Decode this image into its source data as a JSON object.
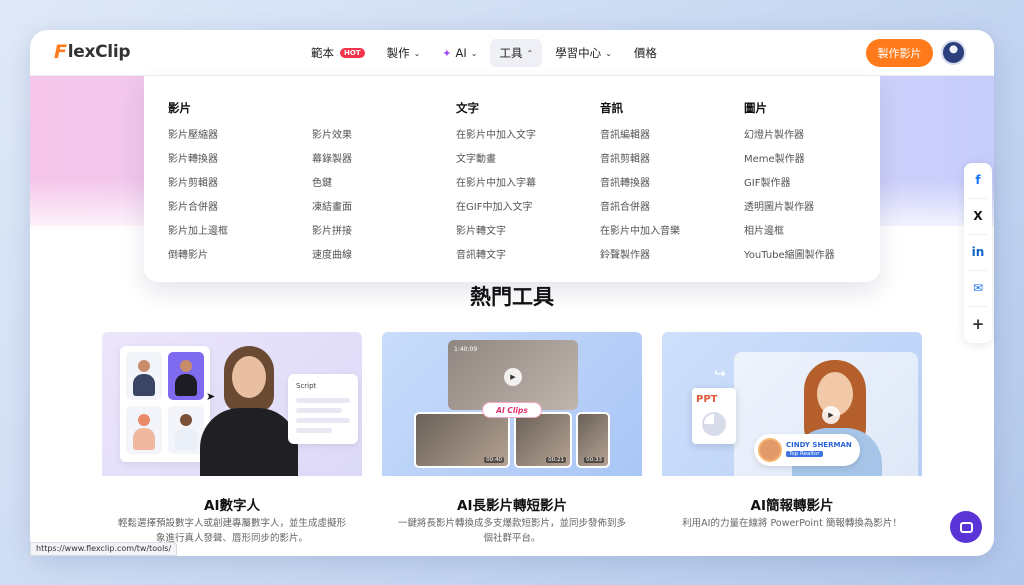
{
  "header": {
    "logo": "FlexClip",
    "nav": [
      {
        "label": "範本",
        "badge": "HOT"
      },
      {
        "label": "製作"
      },
      {
        "label": "AI"
      },
      {
        "label": "工具"
      },
      {
        "label": "學習中心"
      },
      {
        "label": "價格"
      }
    ],
    "cta": "製作影片"
  },
  "dropdown": {
    "columns": [
      {
        "title": "影片",
        "items": [
          "影片壓縮器",
          "影片轉換器",
          "影片剪輯器",
          "影片合併器",
          "影片加上邊框",
          "倒轉影片"
        ]
      },
      {
        "title": "",
        "items": [
          "影片效果",
          "幕錄製器",
          "色鍵",
          "凍結畫面",
          "影片拼接",
          "速度曲線"
        ]
      },
      {
        "title": "文字",
        "items": [
          "在影片中加入文字",
          "文字動畫",
          "在影片中加入字幕",
          "在GIF中加入文字",
          "影片轉文字",
          "音訊轉文字"
        ]
      },
      {
        "title": "音訊",
        "items": [
          "音訊編輯器",
          "音訊剪輯器",
          "音訊轉換器",
          "音訊合併器",
          "在影片中加入音樂",
          "鈴聲製作器"
        ]
      },
      {
        "title": "圖片",
        "items": [
          "幻燈片製作器",
          "Meme製作器",
          "GIF製作器",
          "透明圖片製作器",
          "相片邊框",
          "YouTube縮圖製作器"
        ]
      }
    ]
  },
  "section": {
    "title": "熱門工具",
    "cards": [
      {
        "title": "AI數字人",
        "desc": "輕鬆選擇預設數字人或創建專屬數字人，並生成虛擬形象進行真人發聲、唇形同步的影片。",
        "thumb_text": "Script"
      },
      {
        "title": "AI長影片轉短影片",
        "desc": "一鍵將長影片轉換成多支爆款短影片，並同步發佈到多個社群平台。",
        "thumb_text": "AI Clips",
        "times": [
          "1:40:09",
          "00:40",
          "00:21",
          "00:33"
        ]
      },
      {
        "title": "AI簡報轉影片",
        "desc": "利用AI的力量在線將 PowerPoint 簡報轉換為影片！",
        "thumb_text": "PPT",
        "name_tag": "CINDY SHERMAN",
        "role": "Top Realtor"
      }
    ]
  },
  "share": [
    "f",
    "X",
    "in",
    "✉",
    "+"
  ],
  "status_url": "https://www.flexclip.com/tw/tools/",
  "colors": {
    "accent": "#ff7a1a",
    "hot": "#f2344a",
    "chat": "#5b34d8"
  }
}
